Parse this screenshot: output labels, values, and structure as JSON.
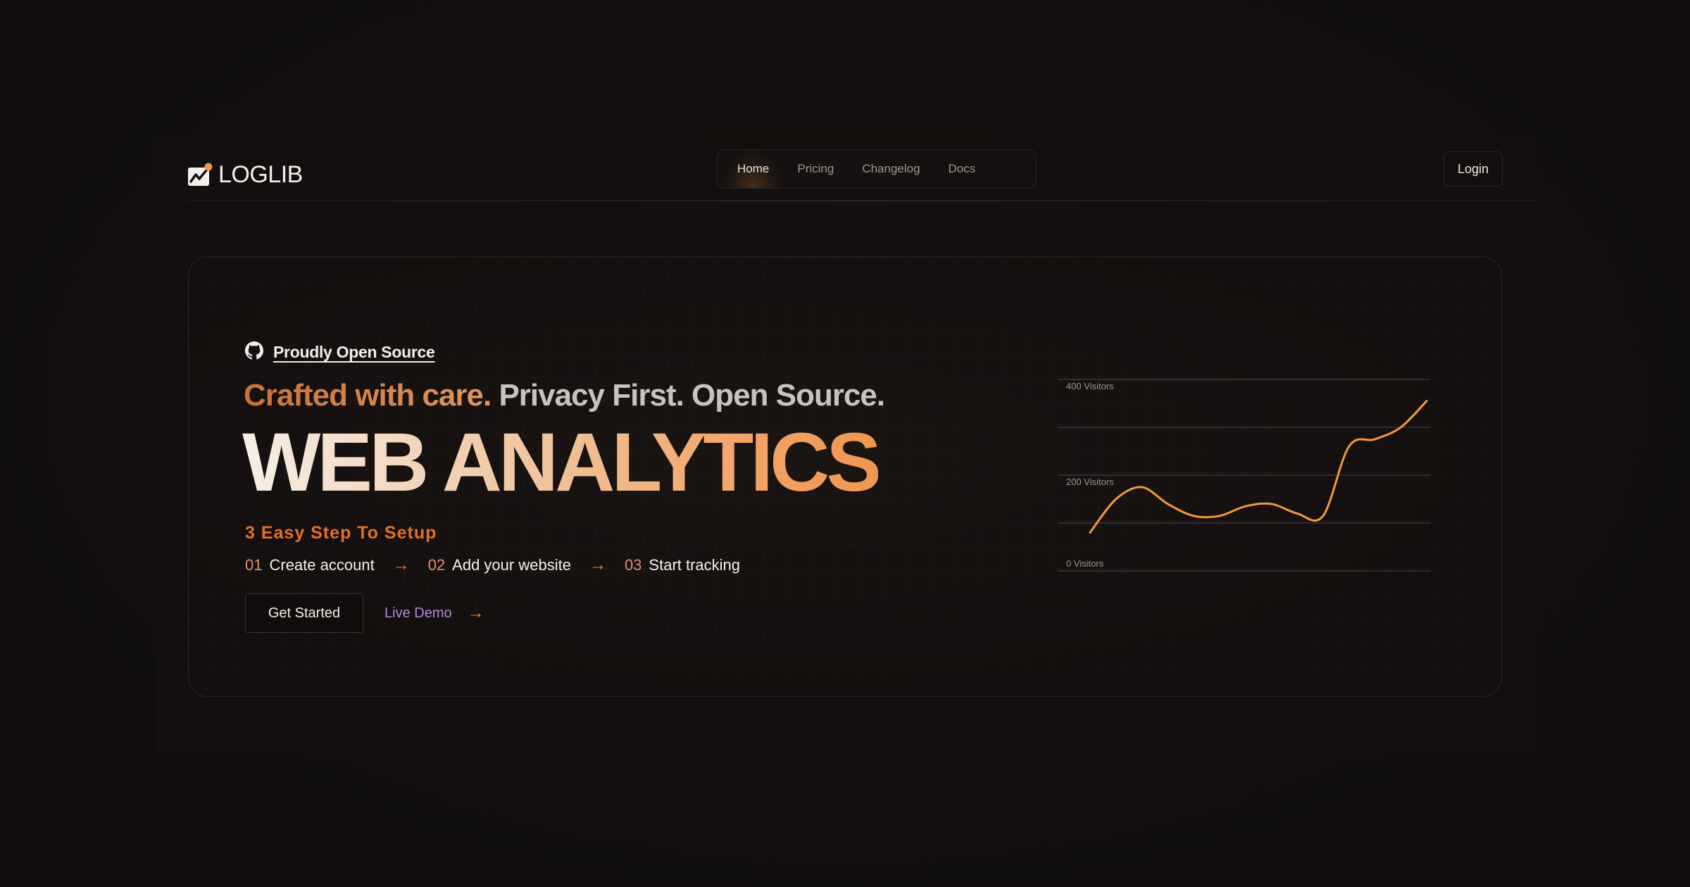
{
  "brand": {
    "name": "LOGLIB"
  },
  "nav": {
    "items": [
      {
        "label": "Home",
        "active": true
      },
      {
        "label": "Pricing",
        "active": false
      },
      {
        "label": "Changelog",
        "active": false
      },
      {
        "label": "Docs",
        "active": false
      }
    ],
    "login_label": "Login"
  },
  "hero": {
    "github_link": "Proudly Open Source",
    "tagline_accent": "Crafted with care.",
    "tagline_rest": " Privacy First. Open Source.",
    "headline": "WEB ANALYTICS",
    "steps_title": "3 Easy Step To Setup",
    "steps": [
      {
        "num": "01",
        "label": "Create account"
      },
      {
        "num": "02",
        "label": "Add your website"
      },
      {
        "num": "03",
        "label": "Start tracking"
      }
    ],
    "get_started_label": "Get Started",
    "live_demo_label": "Live Demo"
  },
  "chart_data": {
    "type": "line",
    "y_tick_labels": [
      "400 Visitors",
      "200 Visitors",
      "0 Visitors"
    ],
    "ylim": [
      0,
      400
    ],
    "grid": true,
    "series": [
      {
        "color": "#f29a38",
        "y": [
          80,
          150,
          175,
          140,
          115,
          115,
          135,
          140,
          120,
          115,
          260,
          275,
          300,
          355
        ]
      }
    ]
  },
  "colors": {
    "accent_orange": "#e56f2b",
    "demo_purple": "#b58ad6",
    "background": "#110e0d"
  },
  "icons": {
    "github": "github-icon",
    "logo": "chart-line-logo-icon",
    "arrow": "arrow-right-icon"
  }
}
